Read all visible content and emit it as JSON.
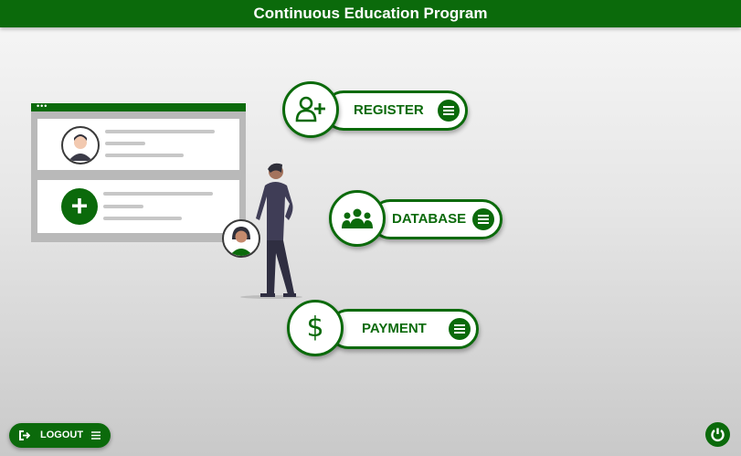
{
  "header": {
    "title": "Continuous Education Program"
  },
  "menu": [
    {
      "label": "REGISTER",
      "icon": "add-user-icon"
    },
    {
      "label": "DATABASE",
      "icon": "users-group-icon"
    },
    {
      "label": "PAYMENT",
      "icon": "dollar-icon"
    }
  ],
  "footer": {
    "logout_label": "LOGOUT",
    "logout_icon": "sign-out-icon",
    "power_icon": "power-icon"
  },
  "colors": {
    "brand": "#0b6a0b",
    "background": "#e6e6e6"
  }
}
